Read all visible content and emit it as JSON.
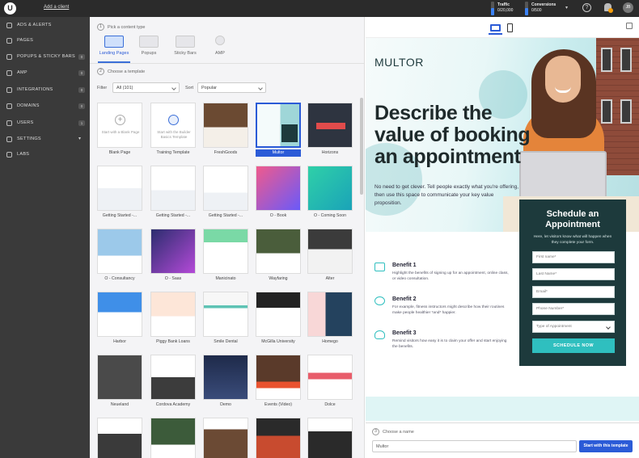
{
  "topbar": {
    "add_client": "Add a client",
    "traffic_label": "Traffic",
    "traffic_value": "0/20,000",
    "conversions_label": "Conversions",
    "conversions_value": "0/500",
    "avatar_initials": "JB",
    "help_icon": "question-icon"
  },
  "sidebar": {
    "items": [
      {
        "label": "ADS & ALERTS",
        "icon": "ads-icon",
        "count": ""
      },
      {
        "label": "PAGES",
        "icon": "pages-icon",
        "count": ""
      },
      {
        "label": "POPUPS & STICKY BARS",
        "icon": "popups-icon",
        "count": "0"
      },
      {
        "label": "AMP",
        "icon": "amp-icon",
        "count": "0"
      },
      {
        "label": "INTEGRATIONS",
        "icon": "integrations-icon",
        "count": "0"
      },
      {
        "label": "DOMAINS",
        "icon": "domains-icon",
        "count": "0"
      },
      {
        "label": "USERS",
        "icon": "users-icon",
        "count": "1"
      },
      {
        "label": "SETTINGS",
        "icon": "settings-icon",
        "count": ""
      },
      {
        "label": "LABS",
        "icon": "labs-icon",
        "count": ""
      }
    ]
  },
  "center": {
    "step1_num": "1",
    "step1_label": "Pick a content type",
    "content_types": [
      "Landing Pages",
      "Popups",
      "Sticky Bars",
      "AMP"
    ],
    "step2_num": "2",
    "step2_label": "Choose a template",
    "filter_label": "Filter",
    "filter_value": "All (101)",
    "sort_label": "Sort",
    "sort_value": "Popular",
    "blank_text": "Start with a Blank Page",
    "training_text": "Start with the Builder Basics Template",
    "templates": [
      "Blank Page",
      "Training Template",
      "FreshGoods",
      "Multor",
      "Horizons",
      "Getting Started -...",
      "Getting Started -...",
      "Getting Started -...",
      "O - Book",
      "O - Coming Soon",
      "O - Consultancy",
      "O - Saas",
      "Manicinato",
      "Wayfaring",
      "Alter",
      "Harbor",
      "Piggy Bank Loans",
      "Smile Dental",
      "McGilla University",
      "Homego",
      "Neueland",
      "Cordova Academy",
      "Demo",
      "Events (Video)",
      "Dolce",
      "",
      "",
      "",
      "",
      ""
    ]
  },
  "preview": {
    "brand": "MULTOR",
    "headline": "Describe the value of booking an appointment",
    "subtext": "No need to get clever. Tell people exactly what you're offering, then use this space to communicate your key value proposition.",
    "form": {
      "title": "Schedule an Appointment",
      "subtitle": "Here, let visitors know what will happen when they complete your form.",
      "fields": [
        "First name*",
        "Last Name*",
        "Email*",
        "Phone Number*",
        "Type of Appointment"
      ],
      "button": "SCHEDULE NOW"
    },
    "benefits": [
      {
        "title": "Benefit 1",
        "text": "Highlight the benefits of signing up for an appointment, online class, or video consultation.",
        "icon": "monitor-icon"
      },
      {
        "title": "Benefit 2",
        "text": "For example, fitness instructors might describe how their routines make people healthier *and* happier.",
        "icon": "heart-icon"
      },
      {
        "title": "Benefit 3",
        "text": "Remind visitors how easy it is to claim your offer and start enjoying the benefits.",
        "icon": "lightbulb-icon"
      }
    ]
  },
  "bottom": {
    "step3_num": "3",
    "step3_label": "Choose a name",
    "name_value": "Multor",
    "start_button": "Start with this template"
  },
  "colors": {
    "accent": "#2b5bd7",
    "teal": "#2fbfbf",
    "sidebar": "#3a3a3a",
    "topbar": "#2b2b2b",
    "form_bg": "#1d3a3c"
  }
}
